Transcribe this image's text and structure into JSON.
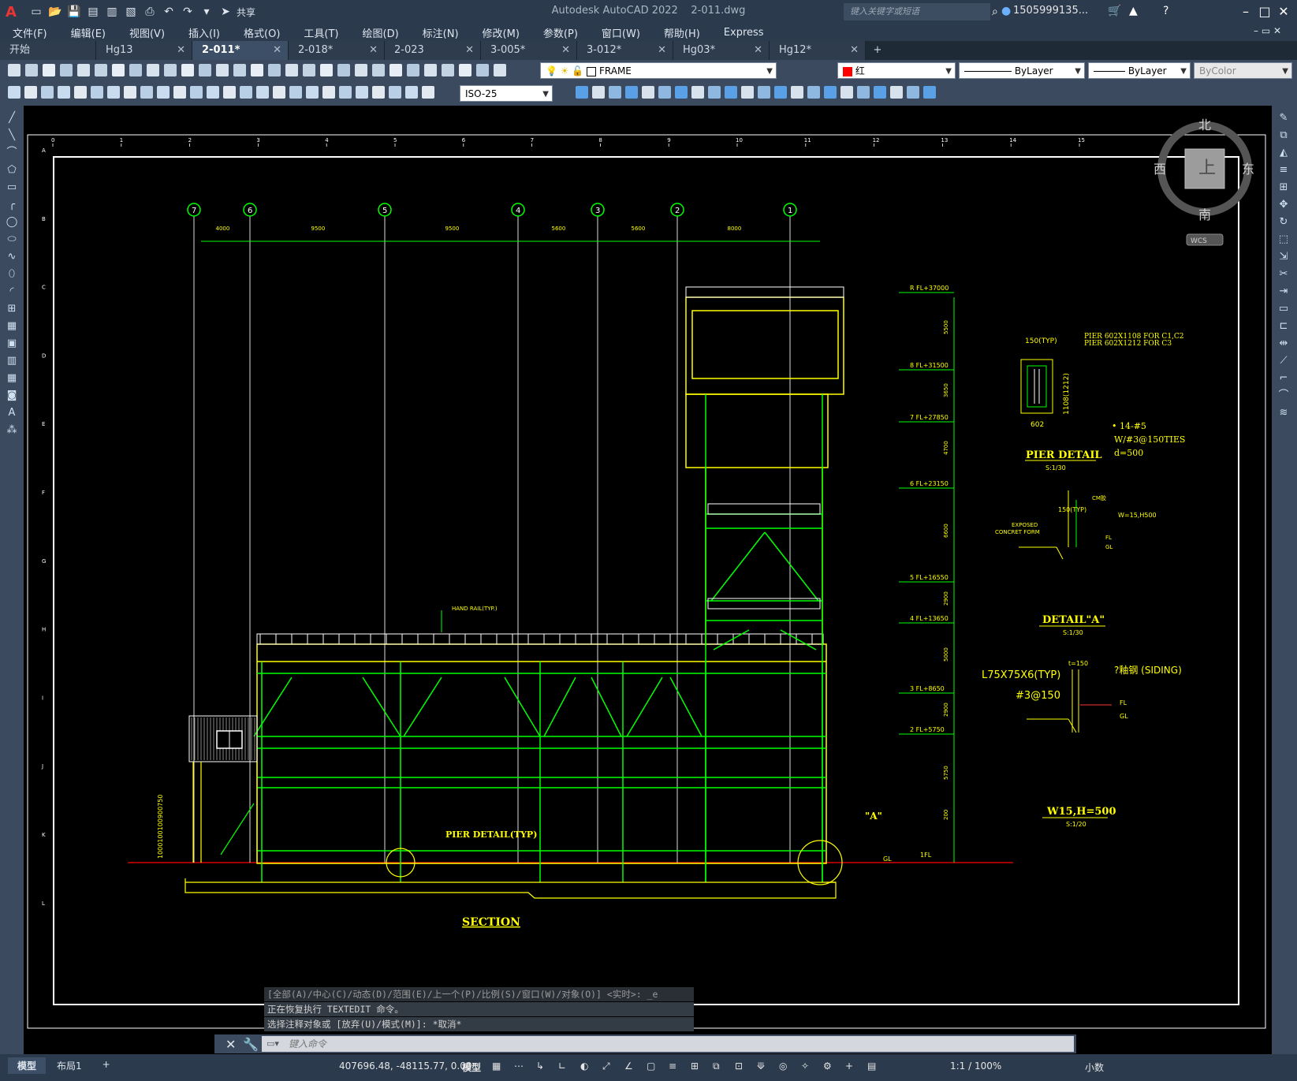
{
  "title_bar": {
    "app_name": "Autodesk AutoCAD 2022",
    "file_name": "2-011.dwg",
    "share_label": "共享",
    "search_placeholder": "键入关键字或短语",
    "user": "1505999135..."
  },
  "menu": [
    "文件(F)",
    "编辑(E)",
    "视图(V)",
    "插入(I)",
    "格式(O)",
    "工具(T)",
    "绘图(D)",
    "标注(N)",
    "修改(M)",
    "参数(P)",
    "窗口(W)",
    "帮助(H)",
    "Express"
  ],
  "tabs": [
    {
      "label": "开始",
      "active": false
    },
    {
      "label": "Hg13",
      "active": false
    },
    {
      "label": "2-011*",
      "active": true
    },
    {
      "label": "2-018*",
      "active": false
    },
    {
      "label": "2-023",
      "active": false
    },
    {
      "label": "3-005*",
      "active": false
    },
    {
      "label": "3-012*",
      "active": false
    },
    {
      "label": "Hg03*",
      "active": false
    },
    {
      "label": "Hg12*",
      "active": false
    }
  ],
  "toolbar": {
    "layer": "FRAME",
    "color": "红",
    "color_hex": "#ff0000",
    "linetype": "ByLayer",
    "lineweight": "ByLayer",
    "plotstyle": "ByColor",
    "dimstyle": "ISO-25"
  },
  "viewcube": {
    "north": "北",
    "south": "南",
    "east": "东",
    "west": "西",
    "top": "上",
    "wcs": "WCS"
  },
  "drawing": {
    "top_ruler": [
      "0",
      "1",
      "2",
      "3",
      "4",
      "5",
      "6",
      "7",
      "8",
      "9",
      "10",
      "11",
      "12",
      "13",
      "14",
      "15"
    ],
    "left_ruler": [
      "A",
      "B",
      "C",
      "D",
      "E",
      "F",
      "G",
      "H",
      "I",
      "J",
      "K",
      "L"
    ],
    "grid_labels": [
      "7",
      "6",
      "5",
      "4",
      "3",
      "2",
      "1"
    ],
    "dims": [
      "4000",
      "9500",
      "9500",
      "5600",
      "5600",
      "8000"
    ],
    "levels": [
      "R FL+37000",
      "8 FL+31500",
      "7 FL+27850",
      "6 FL+23150",
      "5 FL+16550",
      "4 FL+13650",
      "3 FL+8650",
      "2 FL+5750",
      "1FL"
    ],
    "level_dims": [
      "5500",
      "3650",
      "4700",
      "6600",
      "2900",
      "5000",
      "2900",
      "5750",
      "200"
    ],
    "gl": "GL",
    "handrail": "HAND RAIL(TYP.)",
    "pier_detail_typ": "PIER DETAIL(TYP)",
    "detail_a_tag": "\"A\"",
    "section_title": "SECTION",
    "left_dims": "1000100100900750",
    "pier": {
      "title": "PIER DETAIL",
      "scale": "S:1/30",
      "note1": "PIER 602X1108 FOR C1,C2",
      "note2": "PIER 602X1212 FOR C3",
      "typ": "150(TYP)",
      "w": "602",
      "h": "1108(1212)",
      "rebar1": "• 14-#5",
      "rebar2": "W/#3@150TIES",
      "rebar3": "d=500"
    },
    "detail_a": {
      "title": "DETAIL\"A\"",
      "scale": "S:1/30",
      "typ": "150(TYP)",
      "exposed": "EXPOSED",
      "concrete": "CONCRET FORM",
      "cm": "CM胶",
      "w": "W=15,H500",
      "fl": "FL",
      "gl": "GL"
    },
    "w15": {
      "title": "W15,H=500",
      "scale": "S:1/20",
      "angle": "L75X75X6(TYP)",
      "rebar": "#3@150",
      "siding": "?釉钢 (SIDING)",
      "t": "t=150",
      "fl": "FL",
      "gl": "GL"
    }
  },
  "command": {
    "history": [
      "[全部(A)/中心(C)/动态(D)/范围(E)/上一个(P)/比例(S)/窗口(W)/对象(O)] <实时>: _e",
      "正在恢复执行 TEXTEDIT 命令。",
      "选择注释对象或 [放弃(U)/模式(M)]: *取消*"
    ],
    "placeholder": "键入命令"
  },
  "status": {
    "layout_tabs": [
      "模型",
      "布局1"
    ],
    "coords": "407696.48, -48115.77, 0.00",
    "space": "模型",
    "scale": "1:1 / 100%",
    "units": "小数"
  },
  "colors": {
    "drawing_green": "#00ff00",
    "drawing_yellow": "#ffff00",
    "grid_label": "#00ff00",
    "ui_bg": "#3b4a5e"
  }
}
